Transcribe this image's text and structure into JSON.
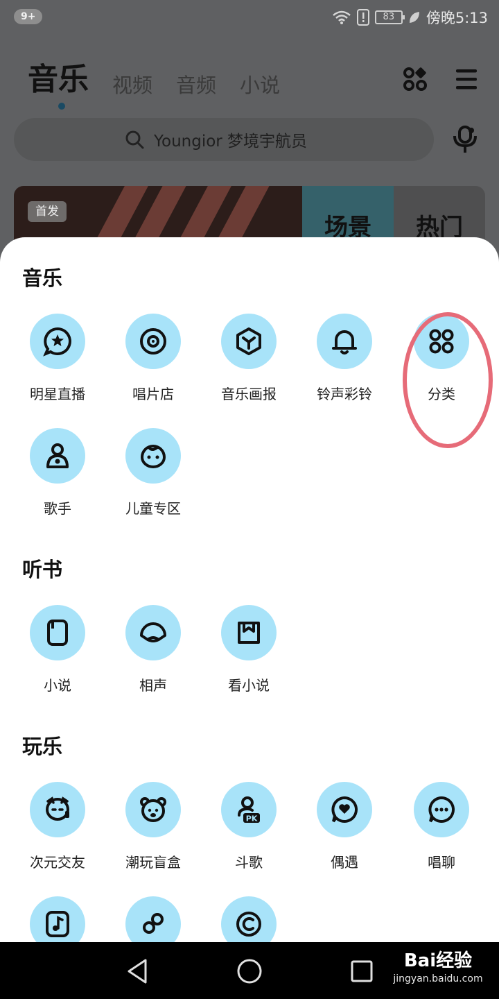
{
  "status_bar": {
    "notification_count": "9+",
    "battery": "83",
    "time": "傍晚5:13",
    "icons": [
      "wifi-icon",
      "alert-icon",
      "battery-icon",
      "leaf-icon"
    ]
  },
  "header": {
    "tabs": [
      {
        "label": "音乐",
        "active": true
      },
      {
        "label": "视频"
      },
      {
        "label": "音频"
      },
      {
        "label": "小说"
      }
    ],
    "icons": [
      "apps-grid-icon",
      "menu-icon"
    ]
  },
  "search": {
    "placeholder": "Youngior 梦境宇航员",
    "icons": [
      "search-icon",
      "mic-icon"
    ]
  },
  "banner": {
    "badge": "首发",
    "tiles": [
      "场景",
      "热门"
    ]
  },
  "sheet": {
    "sections": [
      {
        "title": "音乐",
        "items": [
          {
            "label": "明星直播",
            "icon": "star-chat-icon"
          },
          {
            "label": "唱片店",
            "icon": "vinyl-record-icon"
          },
          {
            "label": "音乐画报",
            "icon": "hexagon-icon"
          },
          {
            "label": "铃声彩铃",
            "icon": "bell-icon"
          },
          {
            "label": "分类",
            "icon": "category-grid-icon"
          },
          {
            "label": "歌手",
            "icon": "singer-icon"
          },
          {
            "label": "儿童专区",
            "icon": "baby-face-icon"
          }
        ]
      },
      {
        "title": "听书",
        "items": [
          {
            "label": "小说",
            "icon": "book-icon"
          },
          {
            "label": "相声",
            "icon": "fan-icon"
          },
          {
            "label": "看小说",
            "icon": "open-book-icon"
          }
        ]
      },
      {
        "title": "玩乐",
        "items": [
          {
            "label": "次元交友",
            "icon": "anime-face-icon"
          },
          {
            "label": "潮玩盲盒",
            "icon": "bear-icon"
          },
          {
            "label": "斗歌",
            "icon": "pk-person-icon"
          },
          {
            "label": "偶遇",
            "icon": "heart-chat-icon"
          },
          {
            "label": "唱聊",
            "icon": "chat-bubble-icon"
          },
          {
            "label": "",
            "icon": "music-note-icon"
          },
          {
            "label": "",
            "icon": "link-icon"
          },
          {
            "label": "",
            "icon": "c-coin-icon"
          }
        ]
      }
    ],
    "highlighted_item": "分类"
  },
  "nav_bar": {
    "icons": [
      "back-icon",
      "home-icon",
      "recents-icon"
    ],
    "watermark": {
      "logo": "Bai经验",
      "url": "jingyan.baidu.com"
    }
  },
  "colors": {
    "icon_circle": "#a8e3f9",
    "highlight": "#e66b78",
    "scrim": "#5f6062"
  }
}
